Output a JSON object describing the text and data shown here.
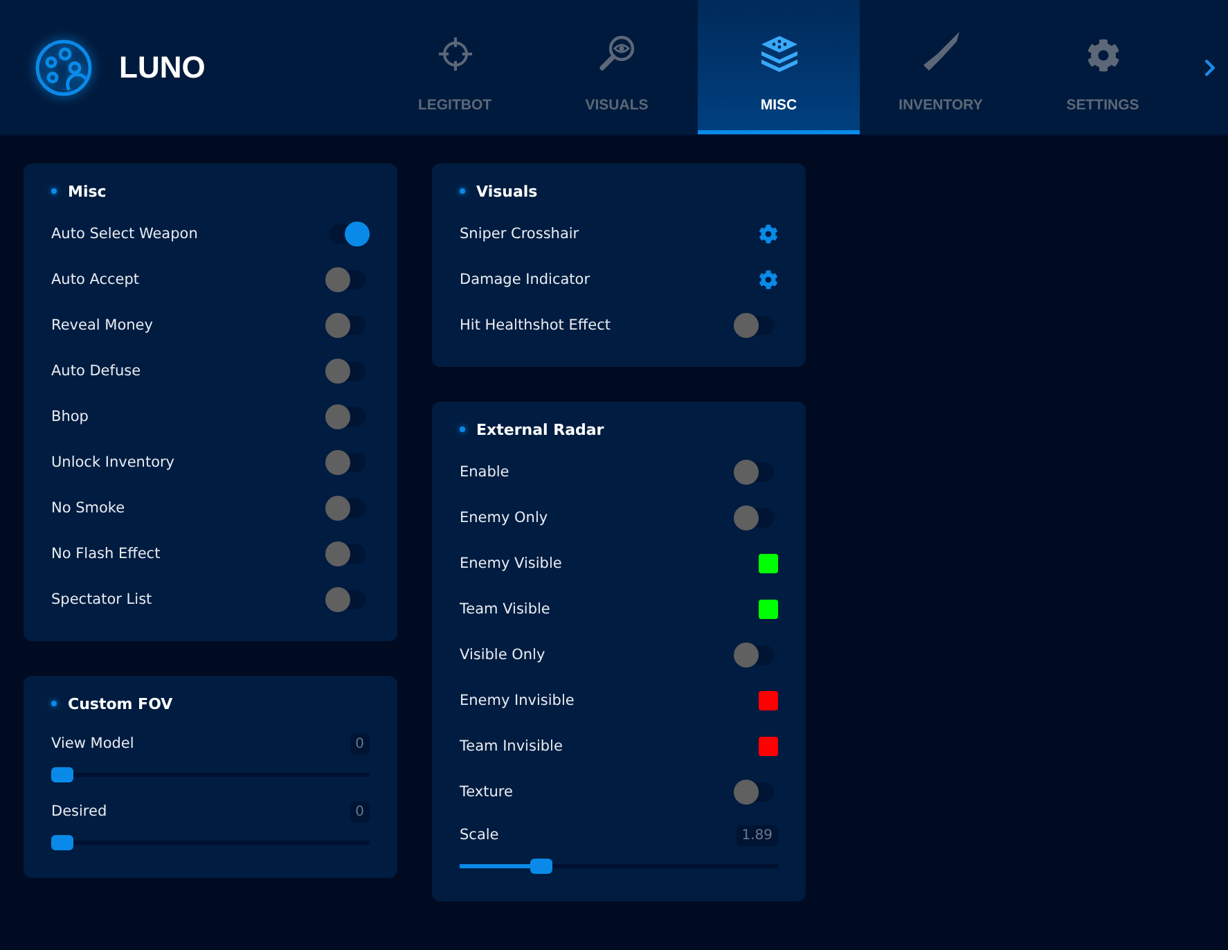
{
  "brand": {
    "name": "LUNO"
  },
  "tabs": [
    {
      "label": "LEGITBOT",
      "selected": false
    },
    {
      "label": "VISUALS",
      "selected": false
    },
    {
      "label": "MISC",
      "selected": true
    },
    {
      "label": "INVENTORY",
      "selected": false
    },
    {
      "label": "SETTINGS",
      "selected": false
    }
  ],
  "columns": [
    [
      {
        "title": "Misc",
        "rows": [
          {
            "kind": "toggle",
            "label": "Auto Select Weapon",
            "on": true
          },
          {
            "kind": "toggle",
            "label": "Auto Accept",
            "on": false
          },
          {
            "kind": "toggle",
            "label": "Reveal Money",
            "on": false
          },
          {
            "kind": "toggle",
            "label": "Auto Defuse",
            "on": false
          },
          {
            "kind": "toggle",
            "label": "Bhop",
            "on": false
          },
          {
            "kind": "toggle",
            "label": "Unlock Inventory",
            "on": false
          },
          {
            "kind": "toggle",
            "label": "No Smoke",
            "on": false
          },
          {
            "kind": "toggle",
            "label": "No Flash Effect",
            "on": false
          },
          {
            "kind": "toggle",
            "label": "Spectator List",
            "on": false
          }
        ]
      },
      {
        "title": "Custom FOV",
        "rows": [
          {
            "kind": "slider",
            "label": "View Model",
            "value": "0",
            "level": 0
          },
          {
            "kind": "slider",
            "label": "Desired",
            "value": "0",
            "level": 0
          }
        ]
      }
    ],
    [
      {
        "title": "Visuals",
        "rows": [
          {
            "kind": "gear",
            "label": "Sniper Crosshair"
          },
          {
            "kind": "gear",
            "label": "Damage Indicator"
          },
          {
            "kind": "toggle",
            "label": "Hit Healthshot Effect",
            "on": false
          }
        ]
      },
      {
        "title": "External Radar",
        "rows": [
          {
            "kind": "toggle",
            "label": "Enable",
            "on": false
          },
          {
            "kind": "toggle",
            "label": "Enemy Only",
            "on": false
          },
          {
            "kind": "color",
            "label": "Enemy Visible",
            "color": "#00ff00"
          },
          {
            "kind": "color",
            "label": "Team Visible",
            "color": "#00ff00"
          },
          {
            "kind": "toggle",
            "label": "Visible Only",
            "on": false
          },
          {
            "kind": "color",
            "label": "Enemy Invisible",
            "color": "#ff0000"
          },
          {
            "kind": "color",
            "label": "Team Invisible",
            "color": "#ff0000"
          },
          {
            "kind": "toggle",
            "label": "Texture",
            "on": false
          },
          {
            "kind": "slider",
            "label": "Scale",
            "value": "1.89",
            "level": 0.24
          }
        ]
      }
    ]
  ]
}
